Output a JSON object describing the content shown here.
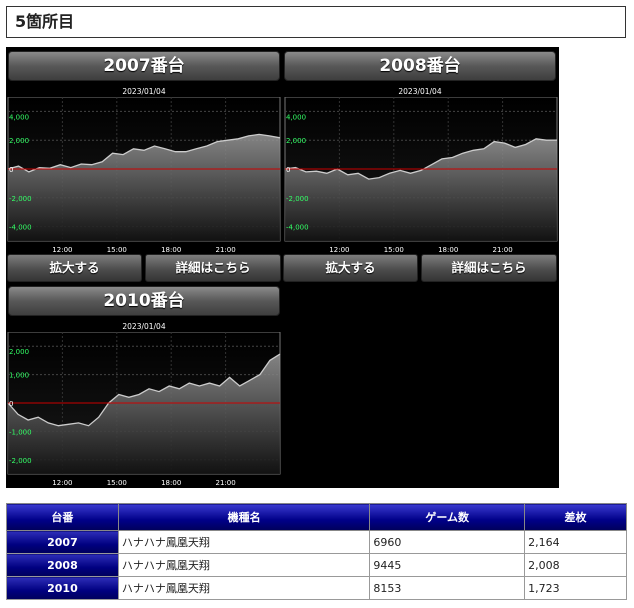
{
  "section": {
    "title": "5箇所目"
  },
  "panels": [
    {
      "machine": "2007番台",
      "date": "2023/01/04",
      "zoom_label": "拡大する",
      "detail_label": "詳細はこちら"
    },
    {
      "machine": "2008番台",
      "date": "2023/01/04",
      "zoom_label": "拡大する",
      "detail_label": "詳細はこちら"
    },
    {
      "machine": "2010番台",
      "date": "2023/01/04"
    }
  ],
  "chart_data": [
    {
      "type": "area",
      "x_ticks": [
        "12:00",
        "15:00",
        "18:00",
        "21:00"
      ],
      "ylim": [
        -5000,
        5000
      ],
      "y_ticks": [
        4000,
        2000,
        0,
        -2000,
        -4000
      ],
      "y_tick_labels": [
        "4,000",
        "2,000",
        "0",
        "-2,000",
        "-4,000"
      ],
      "baseline": 0,
      "grid": true,
      "line_color": "#cccccc",
      "baseline_color": "#cc0000",
      "tick_color": "#33ff66",
      "values": [
        0,
        200,
        -200,
        100,
        50,
        300,
        100,
        350,
        300,
        500,
        1100,
        1000,
        1400,
        1300,
        1600,
        1400,
        1200,
        1200,
        1400,
        1600,
        1900,
        2000,
        2100,
        2300,
        2400,
        2300,
        2164
      ]
    },
    {
      "type": "area",
      "x_ticks": [
        "12:00",
        "15:00",
        "18:00",
        "21:00"
      ],
      "ylim": [
        -5000,
        5000
      ],
      "y_ticks": [
        4000,
        2000,
        0,
        -2000,
        -4000
      ],
      "y_tick_labels": [
        "4,000",
        "2,000",
        "0",
        "-2,000",
        "-4,000"
      ],
      "baseline": 0,
      "grid": true,
      "line_color": "#cccccc",
      "baseline_color": "#cc0000",
      "tick_color": "#33ff66",
      "values": [
        0,
        100,
        -200,
        -150,
        -300,
        0,
        -400,
        -300,
        -700,
        -600,
        -300,
        -100,
        -300,
        -100,
        300,
        700,
        800,
        1100,
        1300,
        1400,
        1900,
        1800,
        1500,
        1700,
        2100,
        2000,
        2008
      ]
    },
    {
      "type": "area",
      "x_ticks": [
        "12:00",
        "15:00",
        "18:00",
        "21:00"
      ],
      "ylim": [
        -2500,
        2500
      ],
      "y_ticks": [
        2000,
        1000,
        0,
        -1000,
        -2000
      ],
      "y_tick_labels": [
        "2,000",
        "1,000",
        "0",
        "-1,000",
        "-2,000"
      ],
      "baseline": 0,
      "grid": true,
      "line_color": "#cccccc",
      "baseline_color": "#cc0000",
      "tick_color": "#33ff66",
      "values": [
        0,
        -400,
        -600,
        -500,
        -700,
        -800,
        -750,
        -700,
        -800,
        -500,
        0,
        300,
        200,
        300,
        500,
        400,
        600,
        500,
        700,
        600,
        700,
        600,
        900,
        600,
        800,
        1000,
        1500,
        1723
      ]
    }
  ],
  "table": {
    "headers": [
      "台番",
      "機種名",
      "ゲーム数",
      "差枚"
    ],
    "rows": [
      {
        "num": "2007",
        "model": "ハナハナ鳳凰天翔",
        "games": "6960",
        "diff": "2,164"
      },
      {
        "num": "2008",
        "model": "ハナハナ鳳凰天翔",
        "games": "9445",
        "diff": "2,008"
      },
      {
        "num": "2010",
        "model": "ハナハナ鳳凰天翔",
        "games": "8153",
        "diff": "1,723"
      }
    ]
  }
}
